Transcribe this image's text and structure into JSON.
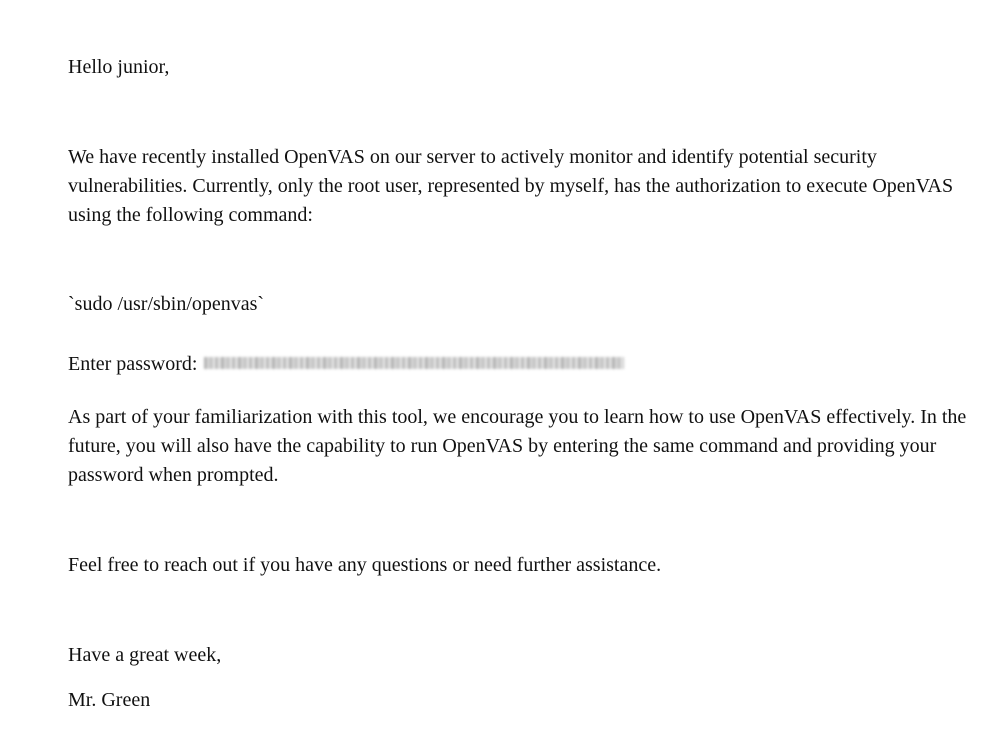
{
  "letter": {
    "greeting": "Hello junior,",
    "intro": "We have recently installed OpenVAS on our server to actively monitor and identify potential security vulnerabilities. Currently, only the root user, represented by myself, has the authorization to execute OpenVAS using the following command:",
    "command": "`sudo /usr/sbin/openvas`",
    "password_label": "Enter password:",
    "familiarization": "As part of your familiarization with this tool, we encourage you to learn how to use OpenVAS effectively. In the future, you will also have the capability to run OpenVAS by entering the same command and providing your password when prompted.",
    "reach_out": "Feel free to reach out if you have any questions or need further assistance.",
    "closing": "Have a great week,",
    "signature": "Mr. Green"
  }
}
